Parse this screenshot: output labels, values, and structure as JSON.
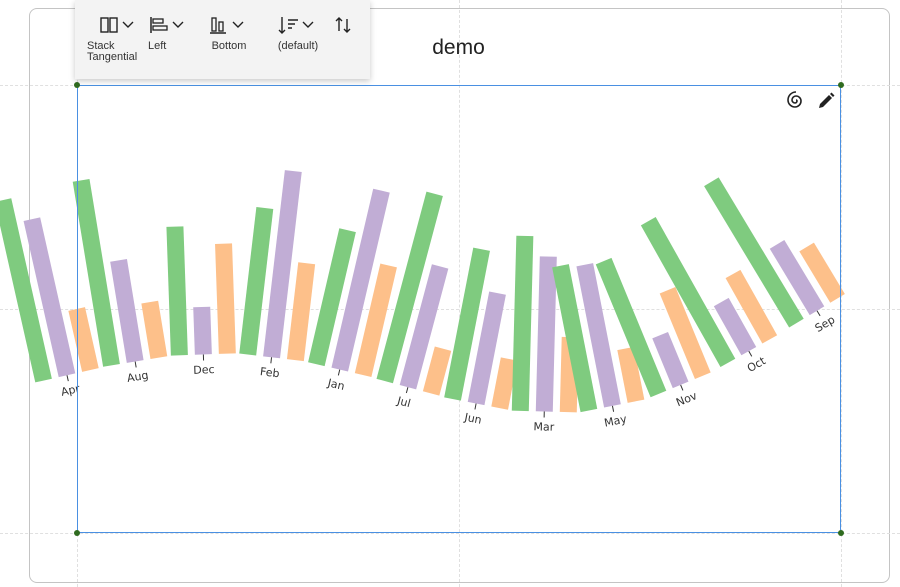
{
  "toolbar": {
    "stack_label": "Stack Tangential",
    "align_label": "Left",
    "anchor_label": "Bottom",
    "sort_label": "(default)"
  },
  "chart_tools": {
    "spiral_icon": "spiral-icon",
    "edit_icon": "pencil-icon"
  },
  "colors": {
    "series1": "#7fcb7f",
    "series2": "#c1add5",
    "series3": "#fdc08a",
    "selection": "#4a90e2"
  },
  "chart_data": {
    "type": "bar",
    "title": "demo",
    "categories": [
      "Apr",
      "Aug",
      "Dec",
      "Feb",
      "Jan",
      "Jul",
      "Jun",
      "Mar",
      "May",
      "Nov",
      "Oct",
      "Sep"
    ],
    "series": [
      {
        "values": [
          148,
          150,
          103,
          118,
          110,
          155,
          122,
          140,
          118,
          115,
          130,
          132
        ]
      },
      {
        "values": [
          128,
          82,
          38,
          150,
          147,
          100,
          90,
          124,
          115,
          43,
          45,
          62
        ]
      },
      {
        "values": [
          50,
          45,
          88,
          78,
          90,
          37,
          40,
          60,
          43,
          74,
          60,
          48
        ]
      }
    ],
    "ylim": [
      0,
      160
    ]
  }
}
